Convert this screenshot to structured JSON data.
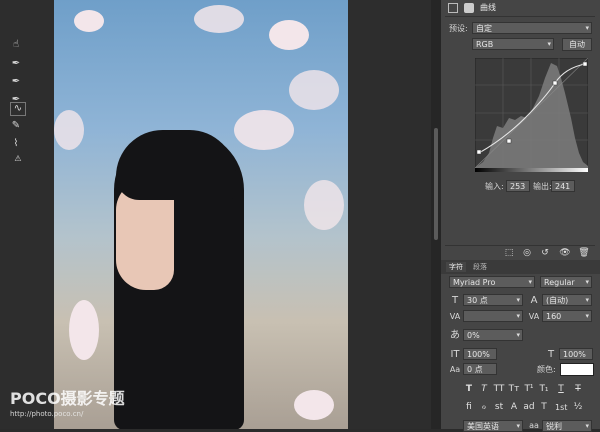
{
  "panel": {
    "title": "曲线",
    "preset_label": "预设:",
    "preset_value": "自定",
    "channel_value": "RGB",
    "auto_label": "自动",
    "input_label": "输入:",
    "input_value": "253",
    "output_label": "输出:",
    "output_value": "241"
  },
  "char_panel": {
    "tab_character": "字符",
    "tab_paragraph": "段落",
    "font_family": "Myriad Pro",
    "font_style": "Regular",
    "font_size": "30 点",
    "leading": "(自动)",
    "kerning": "",
    "tracking": "160",
    "tsume": "0%",
    "vscale": "100%",
    "hscale": "100%",
    "baseline": "0 点",
    "color_label": "颜色:",
    "language": "美国英语",
    "antialias": "锐利",
    "style_buttons": [
      "T",
      "T",
      "TT",
      "Tт",
      "T¹",
      "T₁",
      "T",
      "T"
    ],
    "opentype_buttons": [
      "fi",
      "ℴ",
      "st",
      "A",
      "ad",
      "T",
      "1st",
      "½"
    ]
  },
  "watermark": {
    "brand": "POCO摄影专题",
    "url": "http://photo.poco.cn/"
  },
  "colors": {
    "panel_bg": "#454545",
    "canvas_bg": "#2d2d2d",
    "field_bg": "#5c5c5c"
  }
}
